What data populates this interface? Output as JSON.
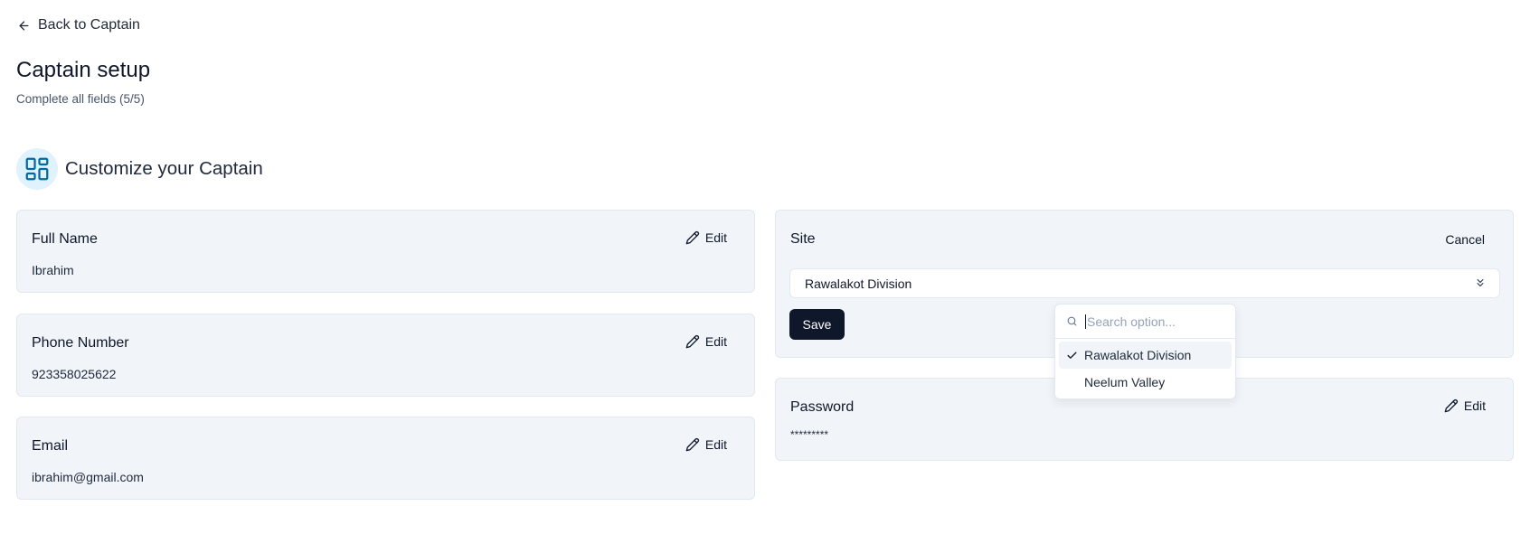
{
  "nav": {
    "back_label": "Back to Captain"
  },
  "header": {
    "title": "Captain setup",
    "subtitle": "Complete all fields (5/5)"
  },
  "section": {
    "title": "Customize your Captain"
  },
  "fields": {
    "full_name": {
      "label": "Full Name",
      "value": "Ibrahim",
      "action": "Edit"
    },
    "phone": {
      "label": "Phone Number",
      "value": "923358025622",
      "action": "Edit"
    },
    "email": {
      "label": "Email",
      "value": "ibrahim@gmail.com",
      "action": "Edit"
    },
    "site": {
      "label": "Site",
      "value": "Rawalakot Division",
      "cancel": "Cancel",
      "save": "Save"
    },
    "password": {
      "label": "Password",
      "value": "*********",
      "action": "Edit"
    }
  },
  "dropdown": {
    "search_placeholder": "Search option...",
    "options": [
      {
        "label": "Rawalakot Division",
        "selected": true
      },
      {
        "label": "Neelum Valley",
        "selected": false
      }
    ]
  },
  "colors": {
    "primary": "#0f172a",
    "card_bg": "#f1f5f9",
    "icon_bg": "#e0f2fe",
    "icon_accent": "#0369a1"
  }
}
